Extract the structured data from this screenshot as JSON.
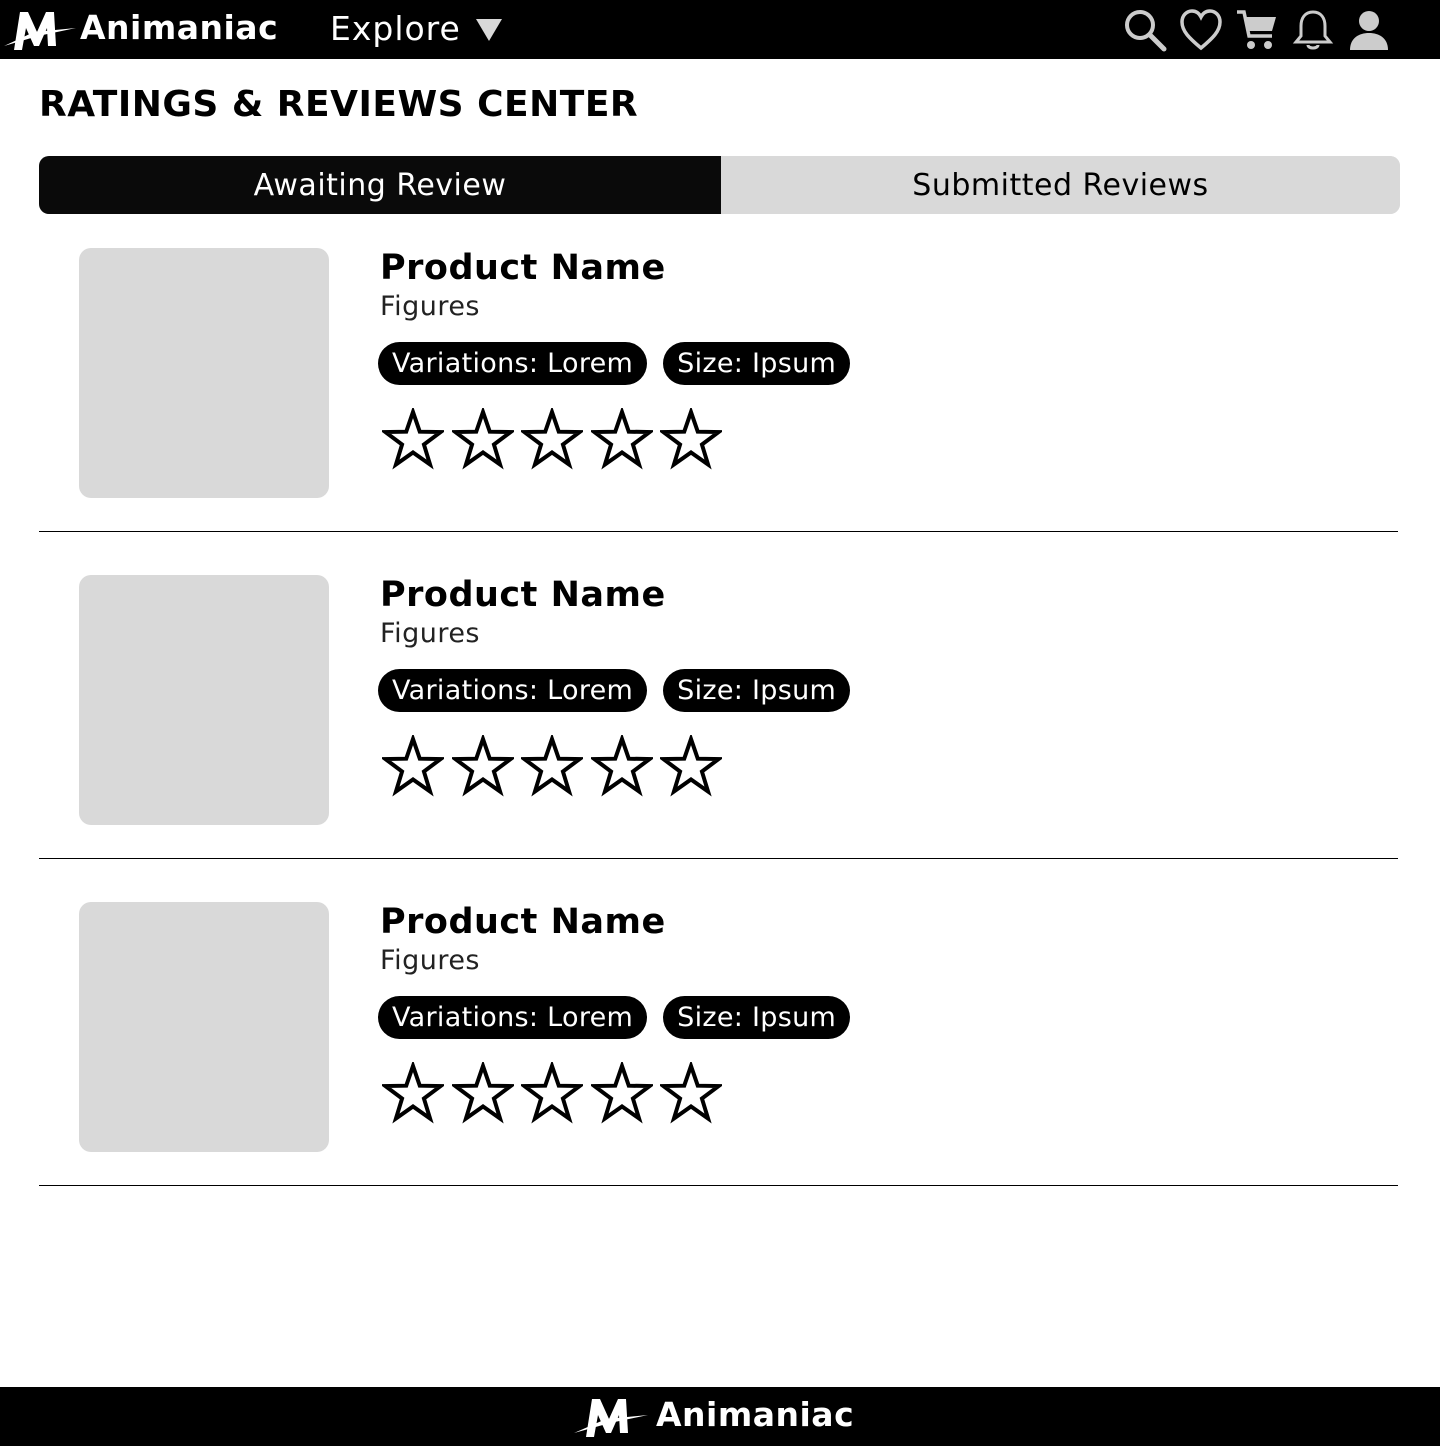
{
  "header": {
    "brand": "Animaniac",
    "explore_label": "Explore",
    "icons": [
      "search-icon",
      "heart-icon",
      "cart-icon",
      "bell-icon",
      "user-icon"
    ]
  },
  "page": {
    "title": "RATINGS & REVIEWS CENTER"
  },
  "tabs": [
    {
      "label": "Awaiting Review",
      "active": true
    },
    {
      "label": "Submitted Reviews",
      "active": false
    }
  ],
  "items": [
    {
      "name": "Product Name",
      "category": "Figures",
      "variation": "Variations: Lorem",
      "size": "Size: Ipsum",
      "rating": 0,
      "max_rating": 5
    },
    {
      "name": "Product Name",
      "category": "Figures",
      "variation": "Variations: Lorem",
      "size": "Size: Ipsum",
      "rating": 0,
      "max_rating": 5
    },
    {
      "name": "Product Name",
      "category": "Figures",
      "variation": "Variations: Lorem",
      "size": "Size: Ipsum",
      "rating": 0,
      "max_rating": 5
    }
  ],
  "footer": {
    "brand": "Animaniac"
  },
  "colors": {
    "bar": "#000000",
    "placeholder": "#d9d9d9",
    "active_tab": "#0a0a0a",
    "inactive_tab": "#d9d9d9"
  }
}
